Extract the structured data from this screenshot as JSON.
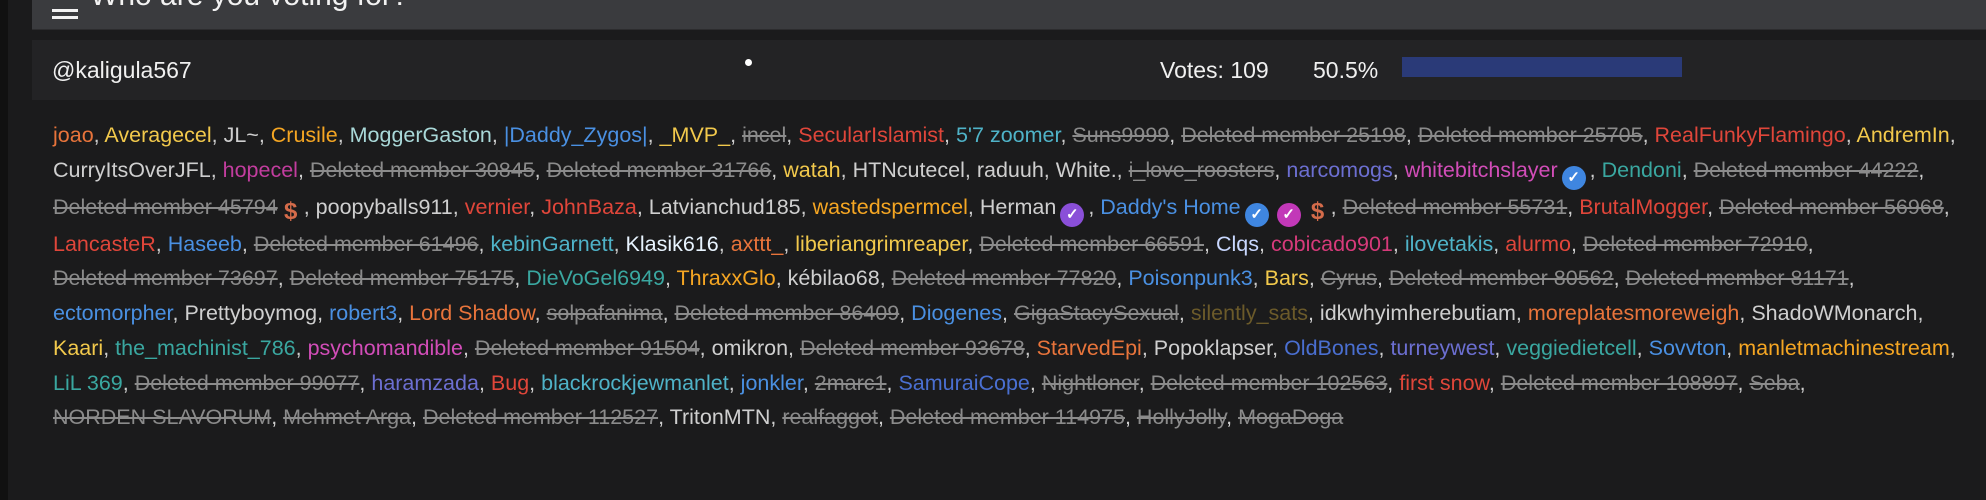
{
  "poll": {
    "title": "Who are you voting for?"
  },
  "candidate": {
    "username": "@kaligula567",
    "votes_label": "Votes: 109",
    "percent_label": "50.5%",
    "percent_value": 50.5
  },
  "voters": [
    {
      "name": "joao",
      "color": "#e8743b"
    },
    {
      "name": "Averagecel",
      "color": "#f2c94c"
    },
    {
      "name": "JL~",
      "color": "#cfcfcf"
    },
    {
      "name": "Crusile",
      "color": "#f5a623"
    },
    {
      "name": "MoggerGaston",
      "color": "#a9d8d8"
    },
    {
      "name": "|Daddy_Zygos|",
      "color": "#4a90e2"
    },
    {
      "name": "_MVP_",
      "color": "#f2c94c"
    },
    {
      "name": "incel",
      "color": "#8b8b8b",
      "deleted": true
    },
    {
      "name": "SecularIslamist",
      "color": "#e0463a"
    },
    {
      "name": "5'7 zoomer",
      "color": "#4fb3c8"
    },
    {
      "name": "Suns9999",
      "color": "#8b8b8b",
      "deleted": true
    },
    {
      "name": "Deleted member 25198",
      "color": "#8b8b8b",
      "deleted": true
    },
    {
      "name": "Deleted member 25705",
      "color": "#8b8b8b",
      "deleted": true
    },
    {
      "name": "RealFunkyFlamingo",
      "color": "#e0463a"
    },
    {
      "name": "AndremIn",
      "color": "#f2c94c"
    },
    {
      "name": "CurryItsOverJFL",
      "color": "#cfcfcf"
    },
    {
      "name": "hopecel",
      "color": "#c23d9e"
    },
    {
      "name": "Deleted member 30845",
      "color": "#8b8b8b",
      "deleted": true
    },
    {
      "name": "Deleted member 31766",
      "color": "#8b8b8b",
      "deleted": true
    },
    {
      "name": "watah",
      "color": "#f2c94c"
    },
    {
      "name": "HTNcutecel",
      "color": "#cfcfcf"
    },
    {
      "name": "raduuh",
      "color": "#cfcfcf"
    },
    {
      "name": "White.",
      "color": "#cfcfcf"
    },
    {
      "name": "i_love_roosters",
      "color": "#8b8b8b",
      "deleted": true
    },
    {
      "name": "narcomogs",
      "color": "#6c6fd1"
    },
    {
      "name": "whitebitchslayer",
      "color": "#d24db8",
      "badges": [
        "verified"
      ]
    },
    {
      "name": "Dendoni",
      "color": "#3aa7a0"
    },
    {
      "name": "Deleted member 44222",
      "color": "#8b8b8b",
      "deleted": true
    },
    {
      "name": "Deleted member 45794",
      "color": "#8b8b8b",
      "deleted": true,
      "badges": [
        "dollar"
      ]
    },
    {
      "name": "poopyballs911",
      "color": "#cfcfcf"
    },
    {
      "name": "vernier",
      "color": "#e0463a"
    },
    {
      "name": "JohnBaza",
      "color": "#e0463a"
    },
    {
      "name": "Latvianchud185",
      "color": "#cfcfcf"
    },
    {
      "name": "wastedspermcel",
      "color": "#f5a623"
    },
    {
      "name": "Herman",
      "color": "#cfcfcf",
      "badges": [
        "purple"
      ]
    },
    {
      "name": "Daddy's Home",
      "color": "#4a90e2",
      "badges": [
        "verified",
        "pink",
        "dollar"
      ]
    },
    {
      "name": "Deleted member 55731",
      "color": "#8b8b8b",
      "deleted": true
    },
    {
      "name": "BrutalMogger",
      "color": "#e0463a"
    },
    {
      "name": "Deleted member 56968",
      "color": "#8b8b8b",
      "deleted": true
    },
    {
      "name": "LancasteR",
      "color": "#e0463a"
    },
    {
      "name": "Haseeb",
      "color": "#4a90e2"
    },
    {
      "name": "Deleted member 61496",
      "color": "#8b8b8b",
      "deleted": true
    },
    {
      "name": "kebinGarnett",
      "color": "#4fb3c8"
    },
    {
      "name": "Klasik616",
      "color": "#e8f4ff"
    },
    {
      "name": "axttt_",
      "color": "#e8743b"
    },
    {
      "name": "liberiangrimreaper",
      "color": "#f2c94c"
    },
    {
      "name": "Deleted member 66591",
      "color": "#8b8b8b",
      "deleted": true
    },
    {
      "name": "Clqs",
      "color": "#c9d8ff"
    },
    {
      "name": "cobicado901",
      "color": "#d63a7a"
    },
    {
      "name": "ilovetakis",
      "color": "#4fb3c8"
    },
    {
      "name": "alurmo",
      "color": "#e0463a"
    },
    {
      "name": "Deleted member 72910",
      "color": "#8b8b8b",
      "deleted": true
    },
    {
      "name": "Deleted member 73697",
      "color": "#8b8b8b",
      "deleted": true
    },
    {
      "name": "Deleted member 75175",
      "color": "#8b8b8b",
      "deleted": true
    },
    {
      "name": "DieVoGel6949",
      "color": "#3aa7a0"
    },
    {
      "name": "ThraxxGlo",
      "color": "#f5a623"
    },
    {
      "name": "kébilao68",
      "color": "#cfcfcf"
    },
    {
      "name": "Deleted member 77820",
      "color": "#8b8b8b",
      "deleted": true
    },
    {
      "name": "Poisonpunk3",
      "color": "#4a90e2"
    },
    {
      "name": "Bars",
      "color": "#f2c94c"
    },
    {
      "name": "Cyrus",
      "color": "#8b8b8b",
      "deleted": true
    },
    {
      "name": "Deleted member 80562",
      "color": "#8b8b8b",
      "deleted": true
    },
    {
      "name": "Deleted member 81171",
      "color": "#8b8b8b",
      "deleted": true
    },
    {
      "name": "ectomorpher",
      "color": "#4a90e2"
    },
    {
      "name": "Prettyboymog",
      "color": "#cfcfcf"
    },
    {
      "name": "robert3",
      "color": "#4a90e2"
    },
    {
      "name": "Lord Shadow",
      "color": "#e8743b"
    },
    {
      "name": "solpafanima",
      "color": "#8b8b8b",
      "deleted": true
    },
    {
      "name": "Deleted member 86409",
      "color": "#8b8b8b",
      "deleted": true
    },
    {
      "name": "Diogenes",
      "color": "#4a90e2"
    },
    {
      "name": "GigaStacySexual",
      "color": "#8b8b8b",
      "deleted": true
    },
    {
      "name": "silently_sats",
      "color": "#6b5a2a"
    },
    {
      "name": "idkwhyimherebutiam",
      "color": "#cfcfcf"
    },
    {
      "name": "moreplatesmoreweigh",
      "color": "#e8743b"
    },
    {
      "name": "ShadoWMonarch",
      "color": "#cfcfcf"
    },
    {
      "name": "Kaari",
      "color": "#f2c94c"
    },
    {
      "name": "the_machinist_786",
      "color": "#3aa7a0"
    },
    {
      "name": "psychomandible",
      "color": "#d24db8"
    },
    {
      "name": "Deleted member 91504",
      "color": "#8b8b8b",
      "deleted": true
    },
    {
      "name": "omikron",
      "color": "#cfcfcf"
    },
    {
      "name": "Deleted member 93678",
      "color": "#8b8b8b",
      "deleted": true
    },
    {
      "name": "StarvedEpi",
      "color": "#e8743b"
    },
    {
      "name": "Popoklapser",
      "color": "#cfcfcf"
    },
    {
      "name": "OldBones",
      "color": "#4a6fd1"
    },
    {
      "name": "turneywest",
      "color": "#6c6fd1"
    },
    {
      "name": "veggiedietcell",
      "color": "#3aa7a0"
    },
    {
      "name": "Sovvton",
      "color": "#4a90e2"
    },
    {
      "name": "manletmachinestream",
      "color": "#f5a623"
    },
    {
      "name": "LiL 369",
      "color": "#3aa7a0"
    },
    {
      "name": "Deleted member 99077",
      "color": "#8b8b8b",
      "deleted": true
    },
    {
      "name": "haramzada",
      "color": "#6c6fd1"
    },
    {
      "name": "Bug",
      "color": "#e0463a"
    },
    {
      "name": "blackrockjewmanlet",
      "color": "#4fb3c8"
    },
    {
      "name": "jonkler",
      "color": "#4a90e2"
    },
    {
      "name": "2marc1",
      "color": "#8b8b8b",
      "deleted": true
    },
    {
      "name": "SamuraiCope",
      "color": "#4a6fd1"
    },
    {
      "name": "Nightloner",
      "color": "#8b8b8b",
      "deleted": true
    },
    {
      "name": "Deleted member 102563",
      "color": "#8b8b8b",
      "deleted": true
    },
    {
      "name": "first snow",
      "color": "#e0463a"
    },
    {
      "name": "Deleted member 108897",
      "color": "#8b8b8b",
      "deleted": true
    },
    {
      "name": "Seba",
      "color": "#8b8b8b",
      "deleted": true
    },
    {
      "name": "NORDEN SLAVORUM",
      "color": "#8b8b8b",
      "deleted": true
    },
    {
      "name": "Mehmet Arga",
      "color": "#8b8b8b",
      "deleted": true
    },
    {
      "name": "Deleted member 112527",
      "color": "#8b8b8b",
      "deleted": true
    },
    {
      "name": "TritonMTN",
      "color": "#cfcfcf"
    },
    {
      "name": "realfaggot",
      "color": "#8b8b8b",
      "deleted": true
    },
    {
      "name": "Deleted member 114975",
      "color": "#8b8b8b",
      "deleted": true
    },
    {
      "name": "HollyJolly",
      "color": "#8b8b8b",
      "deleted": true
    },
    {
      "name": "MogaDoga",
      "color": "#8b8b8b",
      "deleted": true
    }
  ]
}
